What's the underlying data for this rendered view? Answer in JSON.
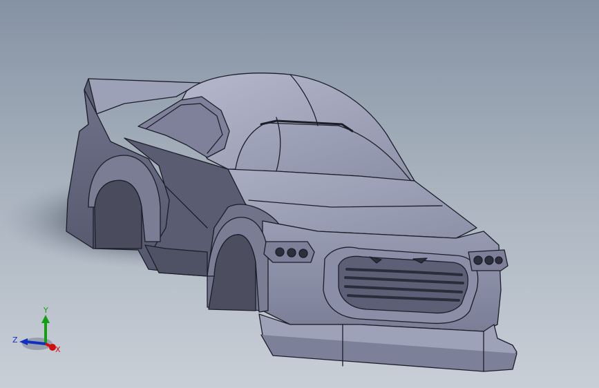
{
  "viewport": {
    "background_top": "#8592a3",
    "background_bottom": "#c9cfd7",
    "model": "car-body-shell"
  },
  "triad": {
    "x_label": "X",
    "y_label": "Y",
    "z_label": "Z",
    "x_color": "#d01010",
    "y_color": "#10a010",
    "z_color": "#1030c0"
  }
}
